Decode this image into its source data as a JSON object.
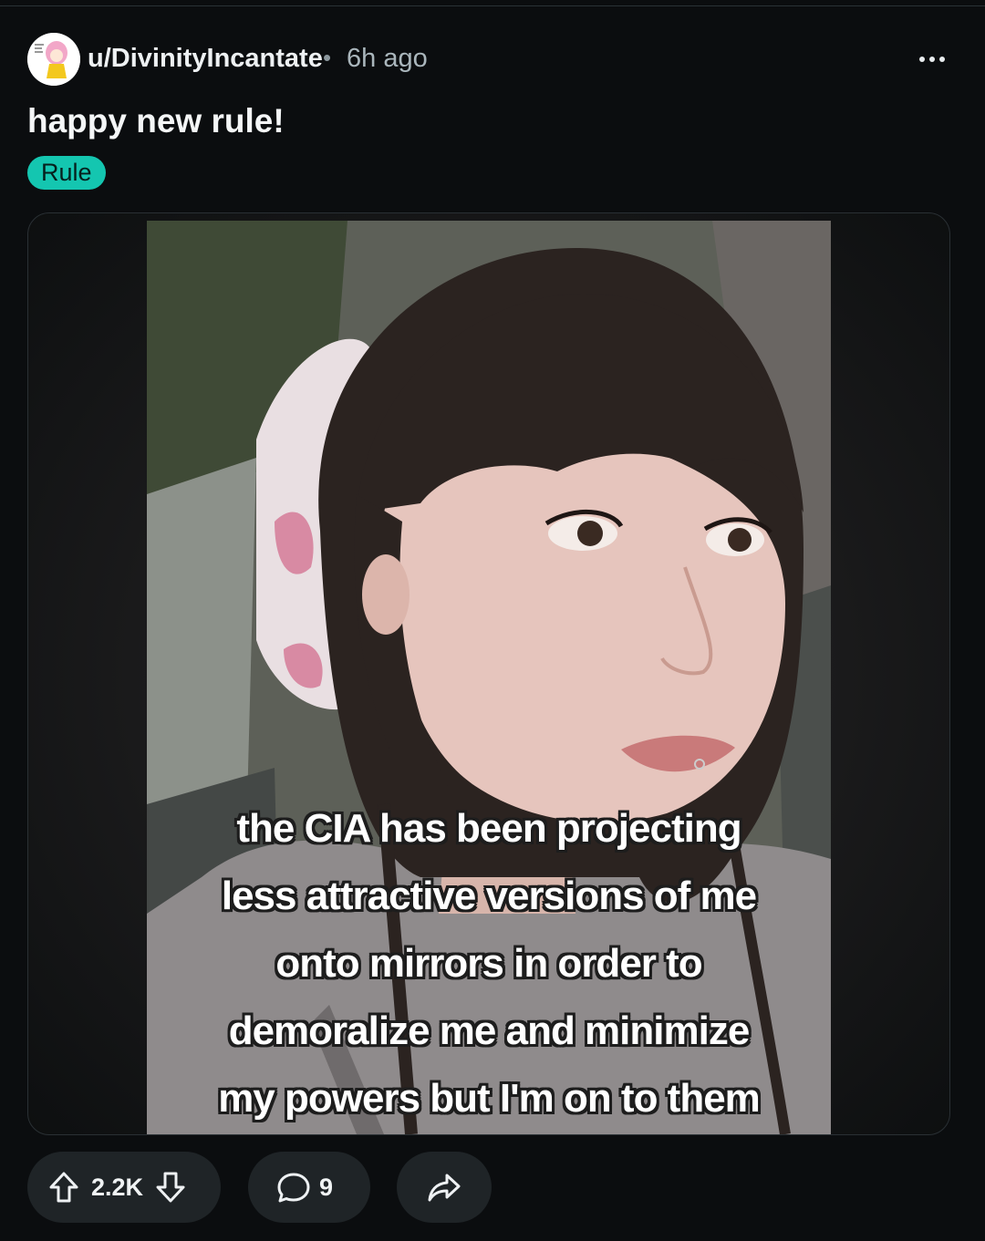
{
  "post": {
    "username": "u/DivinityIncantate",
    "separator": "•",
    "timestamp": "6h ago",
    "title": "happy new rule!",
    "flair": "Rule"
  },
  "media": {
    "caption_lines": [
      "the CIA has been projecting",
      "less attractive versions of me",
      "onto mirrors in order to",
      "demoralize me and minimize",
      "my powers but I'm on to them"
    ]
  },
  "actions": {
    "upvote_icon": "upvote-arrow-icon",
    "vote_count": "2.2K",
    "downvote_icon": "downvote-arrow-icon",
    "comment_icon": "speech-bubble-icon",
    "comment_count": "9",
    "share_icon": "share-arrow-icon"
  },
  "colors": {
    "background": "#0b0d0f",
    "flair_bg": "#14c6b0",
    "pill_bg": "#1f2427"
  }
}
